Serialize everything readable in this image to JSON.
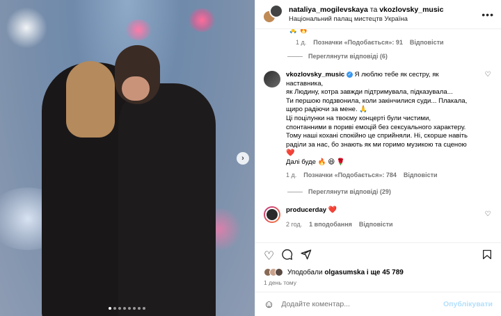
{
  "header": {
    "user1": "nataliya_mogilevskaya",
    "conj": "та",
    "user2": "vkozlovsky_music",
    "location": "Національний палац мистецтв Україна",
    "more_icon": "more-horizontal-icon"
  },
  "comments": {
    "top_comment": {
      "emojis": "🙏 🔥",
      "time": "1 д.",
      "likes": "Позначки «Подобається»: 91",
      "reply": "Відповісти"
    },
    "view_replies_1": "Переглянути відповіді (6)",
    "main_comment": {
      "username": "vkozlovsky_music",
      "lines": [
        "Я люблю тебе як сестру, як наставника,",
        "як Людину, котра завжди підтримувала, підказувала...",
        "Ти першою подзвонила, коли закінчилися суди... Плакала,",
        "щиро радіючи за мене. 🙏",
        "Ці поцілунки на твоєму концерті були чистими,",
        "спонтанними в пориві емоцій без сексуального характеру.",
        "Тому наші кохані спокійно це сприйняли. Ні, скорше навіть",
        "раділи за нас, бо знають як ми горимо музикою та сценою",
        "❤️",
        "Далі буде 🔥 😆 🌹"
      ],
      "time": "1 д.",
      "likes": "Позначки «Подобається»: 784",
      "reply": "Відповісти"
    },
    "view_replies_2": "Переглянути відповіді (29)",
    "producer_comment": {
      "username": "producerday",
      "text": "❤️",
      "time": "2 год.",
      "likes": "1 вподобання",
      "reply": "Відповісти"
    }
  },
  "actions": {
    "icons": [
      "heart-icon",
      "comment-icon",
      "share-icon",
      "bookmark-icon"
    ],
    "liked_by_prefix": "Уподобали",
    "liked_by_user": "olgasumska",
    "liked_by_rest": "і ще 45 789",
    "date": "1 день тому"
  },
  "add_comment": {
    "placeholder": "Додайте коментар...",
    "publish": "Опублікувати"
  },
  "colors": {
    "verified": "#3897f0",
    "heart": "#ed4956",
    "publish": "#b2dffc"
  }
}
